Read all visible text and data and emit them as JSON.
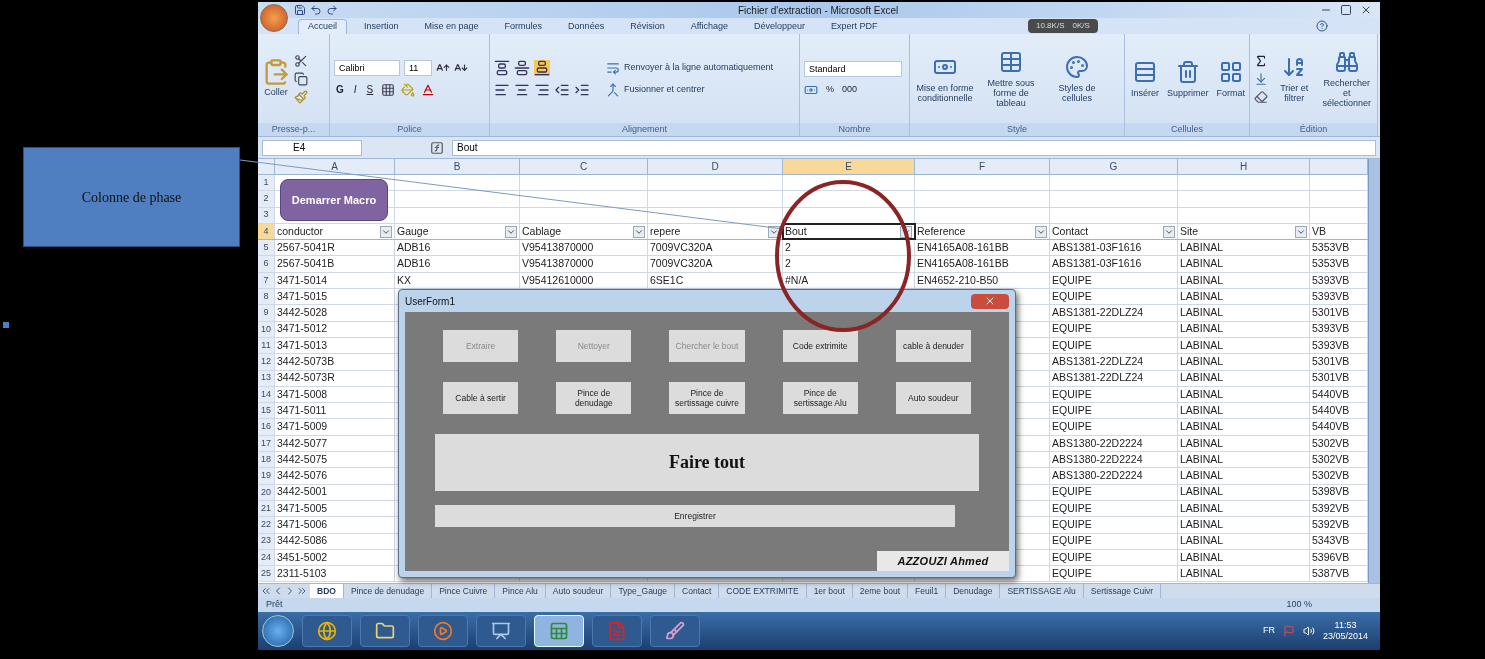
{
  "annotation": {
    "label": "Colonne de phase"
  },
  "window": {
    "title": "Fichier d'extraction - Microsoft Excel",
    "network_badge": {
      "down": "10.8K/S",
      "up": "0K/S"
    }
  },
  "ribbon_tabs": [
    {
      "label": "Accueil",
      "selected": true
    },
    {
      "label": "Insertion",
      "selected": false
    },
    {
      "label": "Mise en page",
      "selected": false
    },
    {
      "label": "Formules",
      "selected": false
    },
    {
      "label": "Données",
      "selected": false
    },
    {
      "label": "Révision",
      "selected": false
    },
    {
      "label": "Affichage",
      "selected": false
    },
    {
      "label": "Développeur",
      "selected": false
    },
    {
      "label": "Expert PDF",
      "selected": false
    }
  ],
  "ribbon": {
    "clipboard": {
      "label": "Presse-p...",
      "paste": "Coller"
    },
    "font": {
      "label": "Police",
      "name": "Calibri",
      "size": "11",
      "bold": "G",
      "italic": "I",
      "underline": "S"
    },
    "alignment": {
      "label": "Alignement",
      "wrap": "Renvoyer à la ligne automatiquement",
      "merge": "Fusionner et centrer"
    },
    "number": {
      "label": "Nombre",
      "format": "Standard",
      "percent": "%",
      "thousands": "000"
    },
    "style": {
      "label": "Style",
      "buttons": [
        "Mise en forme conditionnelle",
        "Mettre sous forme de tableau",
        "Styles de cellules"
      ]
    },
    "cells": {
      "label": "Cellules",
      "buttons": [
        "Insérer",
        "Supprimer",
        "Format"
      ]
    },
    "editing": {
      "label": "Édition",
      "buttons": [
        "Trier et filtrer",
        "Rechercher et sélectionner"
      ]
    }
  },
  "formula_bar": {
    "name_box": "E4",
    "formula": "Bout"
  },
  "sheet": {
    "columns": [
      {
        "letter": "A",
        "selected": false
      },
      {
        "letter": "B",
        "selected": false
      },
      {
        "letter": "C",
        "selected": false
      },
      {
        "letter": "D",
        "selected": false
      },
      {
        "letter": "E",
        "selected": true
      },
      {
        "letter": "F",
        "selected": false
      },
      {
        "letter": "G",
        "selected": false
      },
      {
        "letter": "H",
        "selected": false
      }
    ],
    "macro_button": "Demarrer Macro",
    "top_rows": [
      "1",
      "2",
      "3"
    ],
    "header_row": {
      "number": "4",
      "selected": true,
      "cells": [
        {
          "text": "conductor",
          "filter": true,
          "selected": false
        },
        {
          "text": "Gauge",
          "filter": true,
          "selected": false
        },
        {
          "text": "Cablage",
          "filter": true,
          "selected": false
        },
        {
          "text": "repere",
          "filter": true,
          "selected": false
        },
        {
          "text": "Bout",
          "filter": true,
          "selected": true
        },
        {
          "text": "Reference",
          "filter": true,
          "selected": false
        },
        {
          "text": "Contact",
          "filter": true,
          "selected": false
        },
        {
          "text": "Site",
          "filter": true,
          "selected": false
        },
        {
          "text": "VB",
          "filter": false,
          "selected": false
        }
      ]
    },
    "rows": [
      {
        "number": "5",
        "cells": [
          "2567-5041R",
          "ADB16",
          "V95413870000",
          "7009VC320A",
          "2",
          "EN4165A08-161BB",
          "ABS1381-03F1616",
          "LABINAL",
          "5353VB"
        ]
      },
      {
        "number": "6",
        "cells": [
          "2567-5041B",
          "ADB16",
          "V95413870000",
          "7009VC320A",
          "2",
          "EN4165A08-161BB",
          "ABS1381-03F1616",
          "LABINAL",
          "5353VB"
        ]
      },
      {
        "number": "7",
        "cells": [
          "3471-5014",
          "KX",
          "V95412610000",
          "6SE1C",
          "#N/A",
          "EN4652-210-B50",
          "EQUIPE",
          "LABINAL",
          "5393VB"
        ]
      },
      {
        "number": "8",
        "cells": [
          "3471-5015",
          null,
          null,
          null,
          null,
          null,
          "EQUIPE",
          "LABINAL",
          "5393VB"
        ]
      },
      {
        "number": "9",
        "cells": [
          "3442-5028",
          null,
          null,
          null,
          null,
          null,
          "ABS1381-22DLZ24",
          "LABINAL",
          "5301VB"
        ]
      },
      {
        "number": "10",
        "cells": [
          "3471-5012",
          null,
          null,
          null,
          null,
          null,
          "EQUIPE",
          "LABINAL",
          "5393VB"
        ]
      },
      {
        "number": "11",
        "cells": [
          "3471-5013",
          null,
          null,
          null,
          null,
          null,
          "EQUIPE",
          "LABINAL",
          "5393VB"
        ]
      },
      {
        "number": "12",
        "cells": [
          "3442-5073B",
          null,
          null,
          null,
          null,
          null,
          "ABS1381-22DLZ24",
          "LABINAL",
          "5301VB"
        ]
      },
      {
        "number": "13",
        "cells": [
          "3442-5073R",
          null,
          null,
          null,
          null,
          null,
          "ABS1381-22DLZ24",
          "LABINAL",
          "5301VB"
        ]
      },
      {
        "number": "14",
        "cells": [
          "3471-5008",
          null,
          null,
          null,
          null,
          null,
          "EQUIPE",
          "LABINAL",
          "5440VB"
        ]
      },
      {
        "number": "15",
        "cells": [
          "3471-5011",
          null,
          null,
          null,
          null,
          null,
          "EQUIPE",
          "LABINAL",
          "5440VB"
        ]
      },
      {
        "number": "16",
        "cells": [
          "3471-5009",
          null,
          null,
          null,
          null,
          null,
          "EQUIPE",
          "LABINAL",
          "5440VB"
        ]
      },
      {
        "number": "17",
        "cells": [
          "3442-5077",
          null,
          null,
          null,
          null,
          null,
          "ABS1380-22D2224",
          "LABINAL",
          "5302VB"
        ]
      },
      {
        "number": "18",
        "cells": [
          "3442-5075",
          null,
          null,
          null,
          null,
          null,
          "ABS1380-22D2224",
          "LABINAL",
          "5302VB"
        ]
      },
      {
        "number": "19",
        "cells": [
          "3442-5076",
          null,
          null,
          null,
          null,
          null,
          "ABS1380-22D2224",
          "LABINAL",
          "5302VB"
        ]
      },
      {
        "number": "20",
        "cells": [
          "3442-5001",
          null,
          null,
          null,
          null,
          null,
          "EQUIPE",
          "LABINAL",
          "5398VB"
        ]
      },
      {
        "number": "21",
        "cells": [
          "3471-5005",
          null,
          null,
          null,
          null,
          null,
          "EQUIPE",
          "LABINAL",
          "5392VB"
        ]
      },
      {
        "number": "22",
        "cells": [
          "3471-5006",
          null,
          null,
          null,
          null,
          null,
          "EQUIPE",
          "LABINAL",
          "5392VB"
        ]
      },
      {
        "number": "23",
        "cells": [
          "3442-5086",
          null,
          null,
          null,
          null,
          null,
          "EQUIPE",
          "LABINAL",
          "5343VB"
        ]
      },
      {
        "number": "24",
        "cells": [
          "3451-5002",
          null,
          null,
          null,
          null,
          null,
          "EQUIPE",
          "LABINAL",
          "5396VB"
        ]
      },
      {
        "number": "25",
        "cells": [
          "2311-5103",
          null,
          null,
          null,
          null,
          null,
          "EQUIPE",
          "LABINAL",
          "5387VB"
        ]
      }
    ]
  },
  "userform": {
    "title": "UserForm1",
    "buttons": [
      {
        "label": "Extraire",
        "disabled": true
      },
      {
        "label": "Nettoyer",
        "disabled": true
      },
      {
        "label": "Chercher le bout",
        "disabled": true
      },
      {
        "label": "Code extrimite",
        "disabled": false
      },
      {
        "label": "cable à denuder",
        "disabled": false
      },
      {
        "label": "Cable à sertir",
        "disabled": false
      },
      {
        "label": "Pince de denudage",
        "disabled": false
      },
      {
        "label": "Pince de sertissage cuivre",
        "disabled": false
      },
      {
        "label": "Pince de sertissage Alu",
        "disabled": false
      },
      {
        "label": "Auto soudeur",
        "disabled": false
      }
    ],
    "main_button": "Faire tout",
    "save_button": "Enregistrer",
    "author": "AZZOUZI Ahmed"
  },
  "sheet_tabs": [
    {
      "label": "BDO",
      "selected": true
    },
    {
      "label": "Pince de denudage",
      "selected": false
    },
    {
      "label": "Pince Cuivre",
      "selected": false
    },
    {
      "label": "Pince Alu",
      "selected": false
    },
    {
      "label": "Auto soudeur",
      "selected": false
    },
    {
      "label": "Type_Gauge",
      "selected": false
    },
    {
      "label": "Contact",
      "selected": false
    },
    {
      "label": "CODE EXTRIMITE",
      "selected": false
    },
    {
      "label": "1er bout",
      "selected": false
    },
    {
      "label": "2eme bout",
      "selected": false
    },
    {
      "label": "Feuil1",
      "selected": false
    },
    {
      "label": "Denudage",
      "selected": false
    },
    {
      "label": "SERTISSAGE Alu",
      "selected": false
    },
    {
      "label": "Sertissage Cuivr",
      "selected": false
    }
  ],
  "status_bar": {
    "state": "Prêt",
    "zoom": "100 %"
  },
  "taskbar": {
    "apps": [
      {
        "kind": "browser",
        "active": false
      },
      {
        "kind": "folder",
        "active": false
      },
      {
        "kind": "media",
        "active": false
      },
      {
        "kind": "presentation",
        "active": false
      },
      {
        "kind": "spreadsheet",
        "active": true
      },
      {
        "kind": "pdf",
        "active": false
      },
      {
        "kind": "paint",
        "active": false
      }
    ],
    "language": "FR",
    "time": "11:53",
    "date": "23/05/2014"
  }
}
